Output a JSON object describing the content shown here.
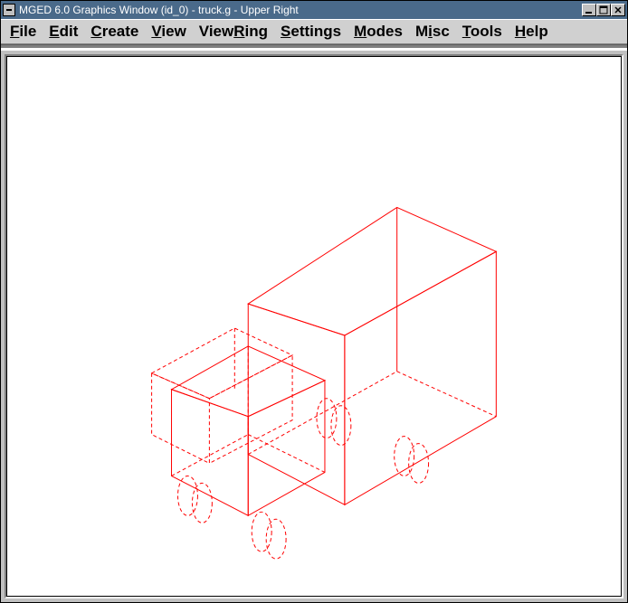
{
  "window": {
    "title": "MGED 6.0 Graphics Window (id_0) - truck.g - Upper Right"
  },
  "menubar": {
    "items": [
      {
        "label": "File",
        "ul": "F"
      },
      {
        "label": "Edit",
        "ul": "E"
      },
      {
        "label": "Create",
        "ul": "C"
      },
      {
        "label": "View",
        "ul": "V"
      },
      {
        "label": "ViewRing",
        "ul": "R"
      },
      {
        "label": "Settings",
        "ul": "S"
      },
      {
        "label": "Modes",
        "ul": "M"
      },
      {
        "label": "Misc",
        "ul": "i"
      },
      {
        "label": "Tools",
        "ul": "T"
      },
      {
        "label": "Help",
        "ul": "H"
      }
    ]
  },
  "viewport": {
    "model": "truck.g",
    "view_name": "Upper Right",
    "wireframe_color": "#ff0000"
  }
}
